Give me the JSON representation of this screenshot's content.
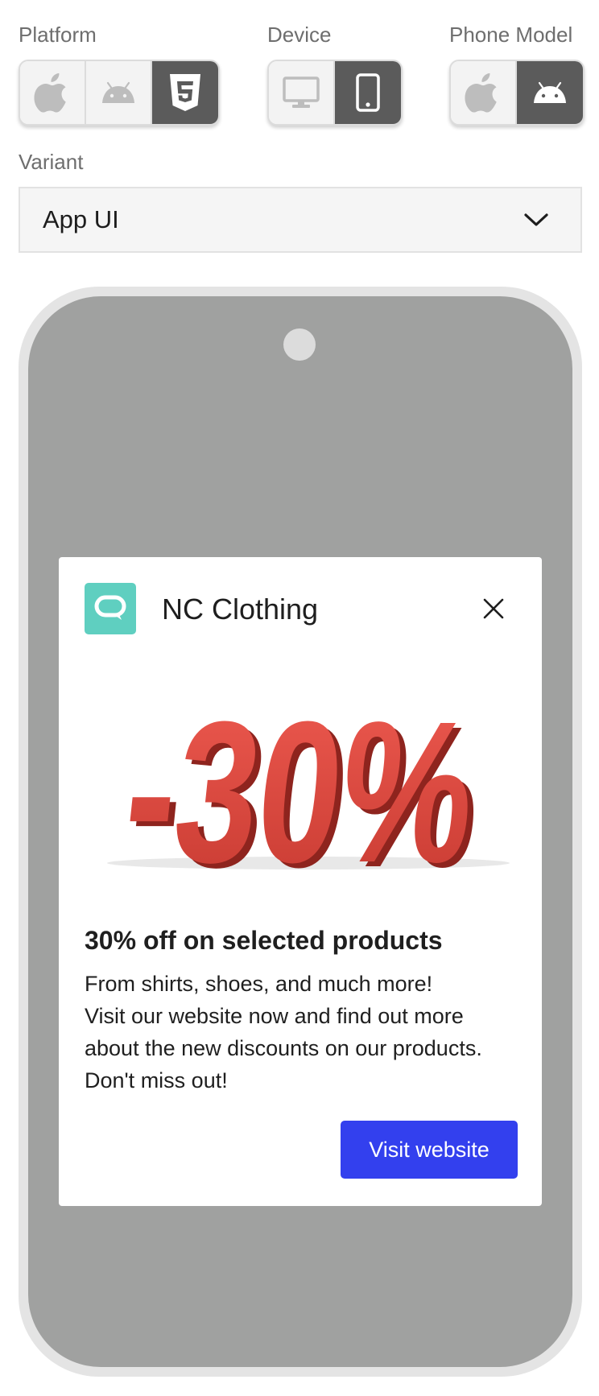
{
  "controls": {
    "platform": {
      "label": "Platform",
      "options": [
        {
          "icon": "apple-icon",
          "selected": false
        },
        {
          "icon": "android-icon",
          "selected": false
        },
        {
          "icon": "html5-icon",
          "selected": true
        }
      ]
    },
    "device": {
      "label": "Device",
      "options": [
        {
          "icon": "desktop-icon",
          "selected": false
        },
        {
          "icon": "mobile-phone-icon",
          "selected": true
        }
      ]
    },
    "phone_model": {
      "label": "Phone Model",
      "options": [
        {
          "icon": "apple-icon",
          "selected": false
        },
        {
          "icon": "android-icon",
          "selected": true
        }
      ]
    },
    "variant": {
      "label": "Variant",
      "value": "App UI"
    }
  },
  "notification": {
    "app_name": "NC Clothing",
    "image_text": "-30%",
    "headline": "30% off on selected products",
    "body_lines": [
      "From shirts, shoes, and much more!",
      "Visit our website now and find out more",
      "about the new discounts on our products.",
      "Don't miss out!"
    ],
    "button_label": "Visit website"
  },
  "colors": {
    "segment_active": "#5b5b5b",
    "segment_inactive": "#f3f3f3",
    "phone_screen": "#a0a1a0",
    "phone_bezel": "#e4e4e4",
    "app_icon": "#5fcfc0",
    "cta": "#3340ee",
    "banner_red": "#e0433a"
  }
}
